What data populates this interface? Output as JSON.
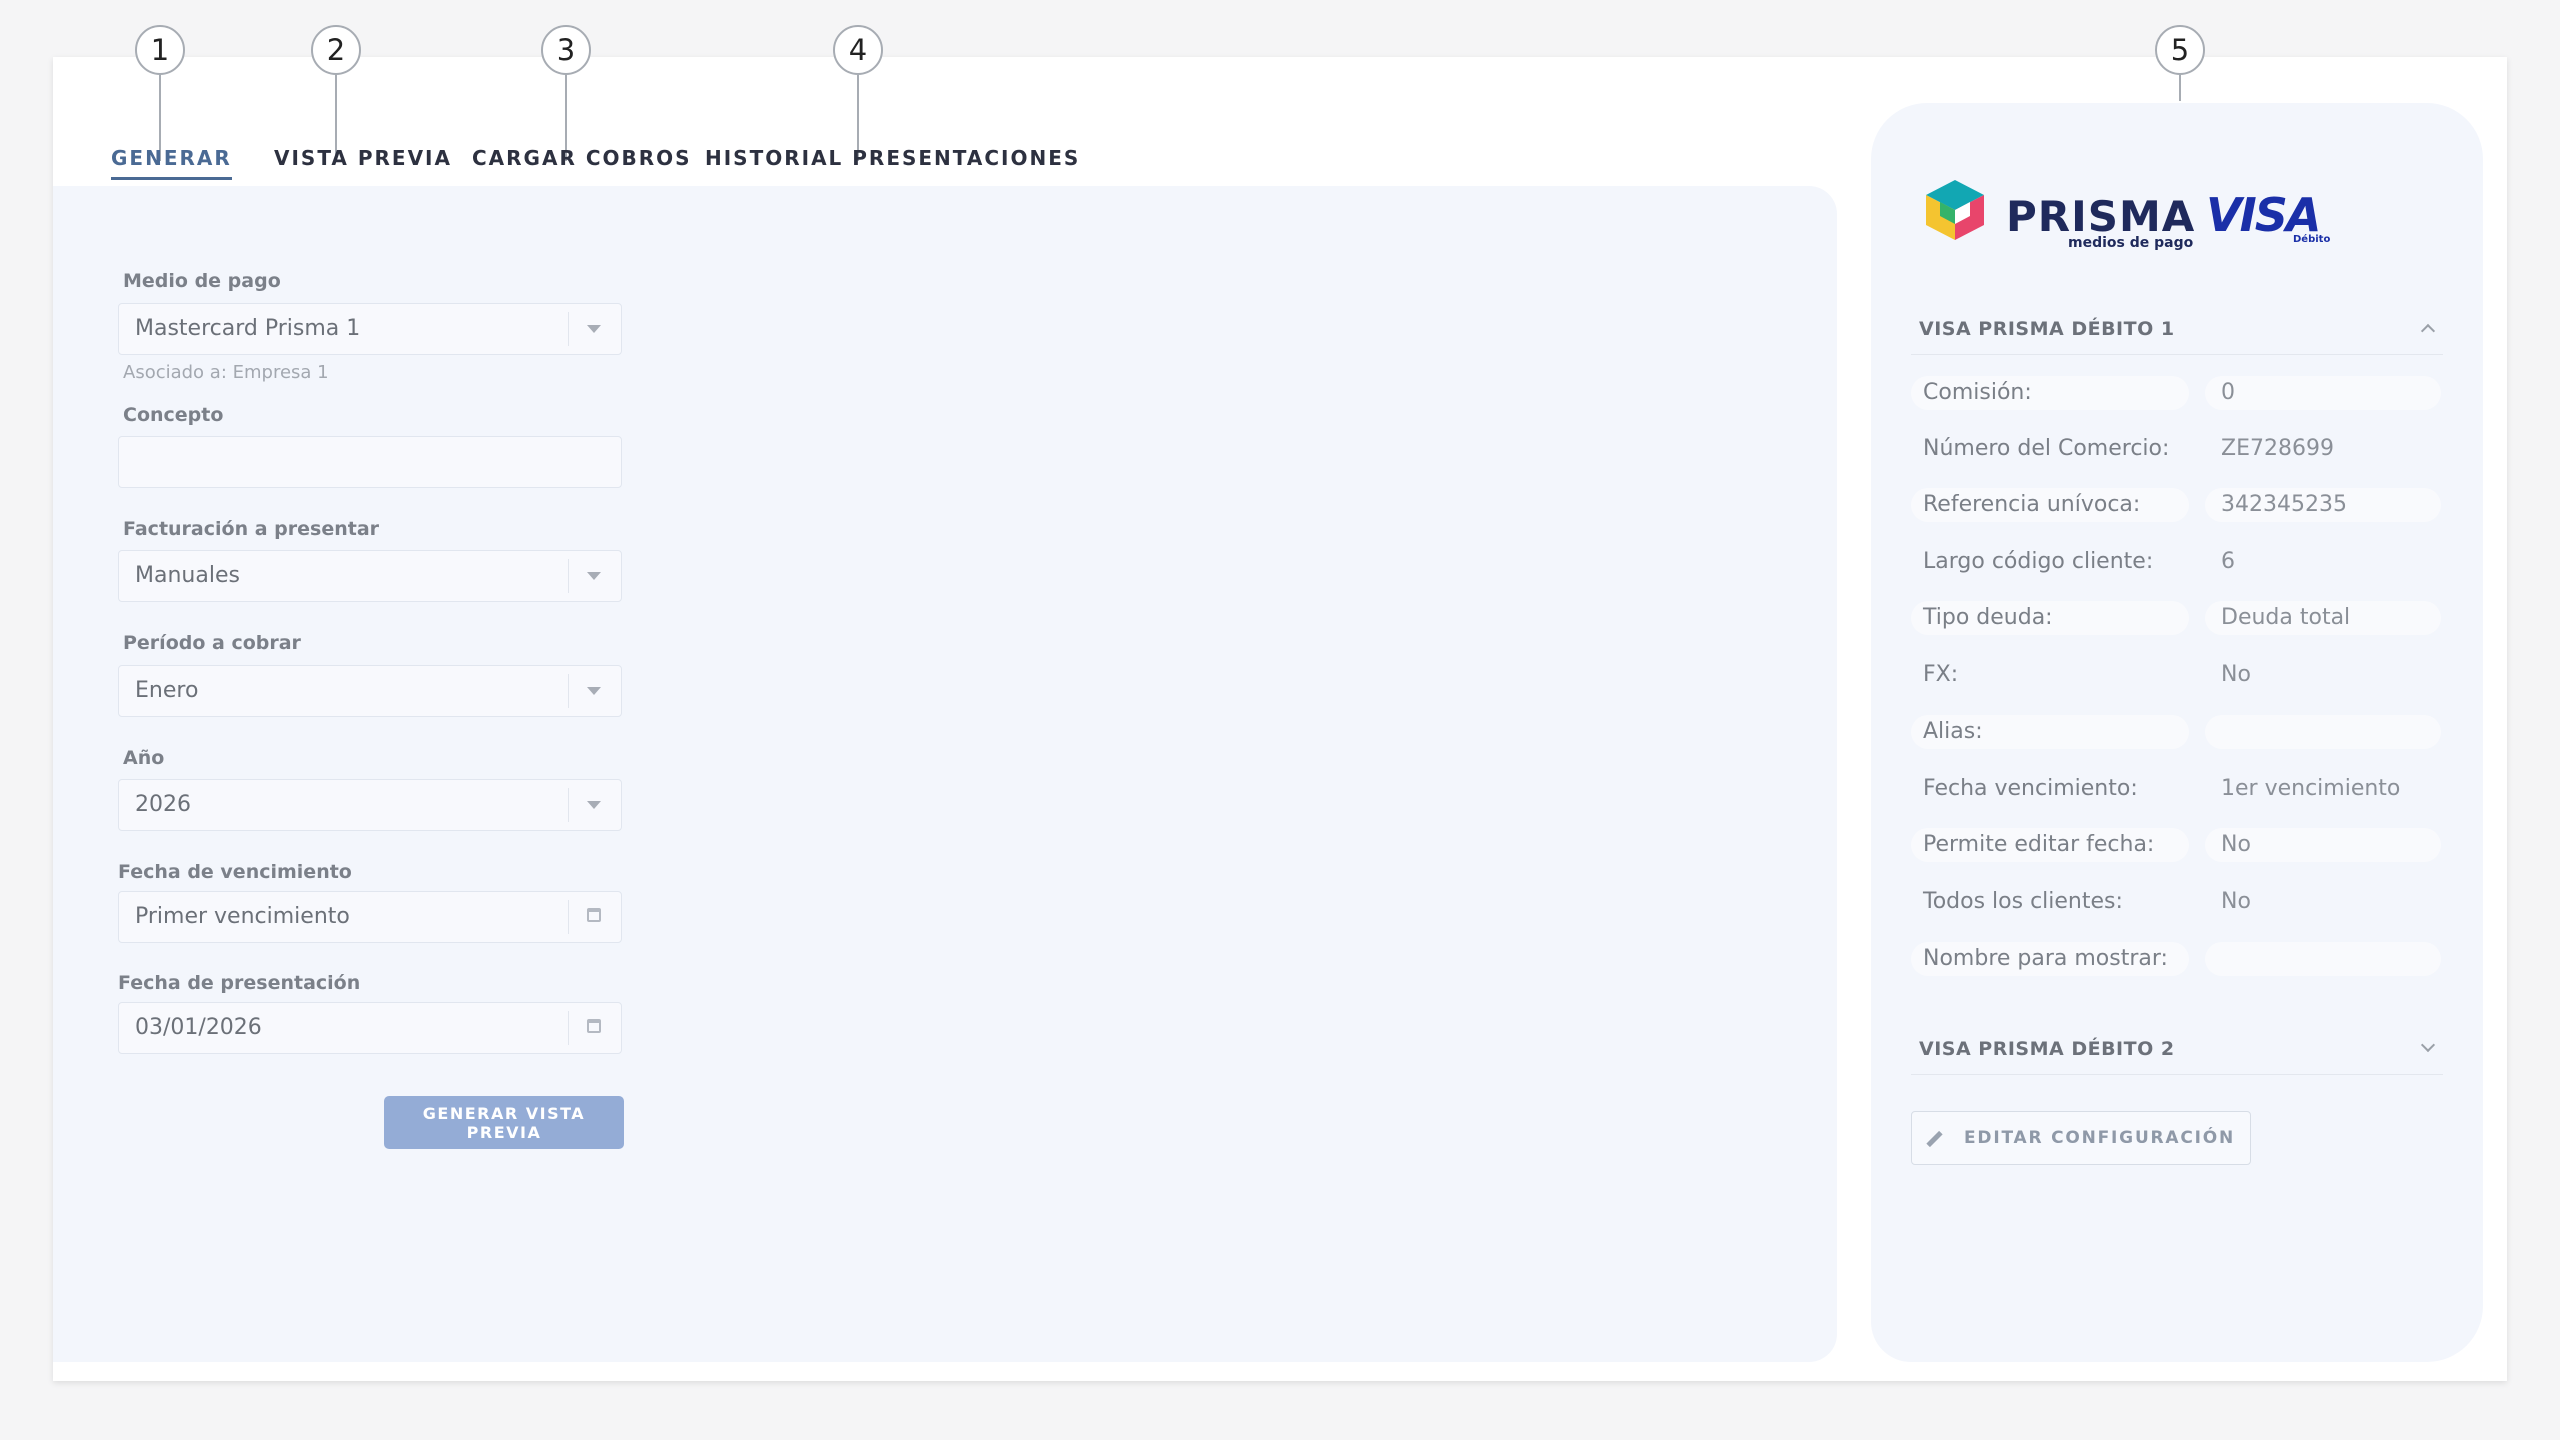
{
  "callouts": [
    "1",
    "2",
    "3",
    "4",
    "5"
  ],
  "tabs": [
    {
      "label": "GENERAR",
      "active": true
    },
    {
      "label": "VISTA PREVIA",
      "active": false
    },
    {
      "label": "CARGAR COBROS",
      "active": false
    },
    {
      "label": "HISTORIAL PRESENTACIONES",
      "active": false
    }
  ],
  "form": {
    "medio_pago": {
      "label": "Medio de pago",
      "value": "Mastercard Prisma 1",
      "hint": "Asociado a: Empresa 1"
    },
    "concepto": {
      "label": "Concepto",
      "value": ""
    },
    "facturacion": {
      "label": "Facturación a presentar",
      "value": "Manuales"
    },
    "periodo": {
      "label": "Período a cobrar",
      "value": "Enero"
    },
    "anio": {
      "label": "Año",
      "value": "2026"
    },
    "vencimiento": {
      "label": "Fecha de vencimiento",
      "value": "Primer vencimiento"
    },
    "presentacion": {
      "label": "Fecha de presentación",
      "value": "03/01/2026"
    },
    "submit_label": "GENERAR VISTA PREVIA"
  },
  "brand": {
    "prisma_name": "PRISMA",
    "prisma_tagline": "medios de pago",
    "visa_name": "VISA",
    "visa_sub": "Débito",
    "colors": {
      "prisma_navy": "#1f2a5c",
      "visa_blue": "#1a2fa8",
      "prisma_teal": "#12a7b3",
      "prisma_yellow": "#f4c430",
      "prisma_pink": "#e8456b",
      "prisma_green": "#34b36a"
    }
  },
  "config": {
    "section1_title": "VISA PRISMA DÉBITO 1",
    "section2_title": "VISA PRISMA DÉBITO 2",
    "rows": [
      {
        "label": "Comisión:",
        "value": "0"
      },
      {
        "label": "Número del Comercio:",
        "value": "ZE728699"
      },
      {
        "label": "Referencia unívoca:",
        "value": "342345235"
      },
      {
        "label": "Largo código cliente:",
        "value": "6"
      },
      {
        "label": "Tipo deuda:",
        "value": "Deuda total"
      },
      {
        "label": "FX:",
        "value": "No"
      },
      {
        "label": "Alias:",
        "value": ""
      },
      {
        "label": "Fecha vencimiento:",
        "value": "1er vencimiento"
      },
      {
        "label": "Permite editar fecha:",
        "value": "No"
      },
      {
        "label": "Todos los clientes:",
        "value": "No"
      },
      {
        "label": "Nombre para mostrar:",
        "value": ""
      }
    ],
    "edit_label": "EDITAR CONFIGURACIÓN"
  }
}
